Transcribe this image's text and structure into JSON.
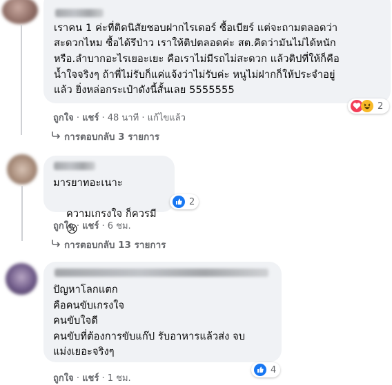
{
  "comments": [
    {
      "author": "",
      "lines": [
        "เราคน 1 ค่ะที่ติดนิสัยชอบฝากไรเดอร์ ซื้อเบียร์ แต่จะถามตลอดว่า",
        "สะดวกไหม ซื้อได้รึป่าว เราให้ติปตลอดค่ะ สต.คิดว่ามันไม่ได้หนัก",
        "หรือ.ลำบากอะไรเยอะเยะ คือเราไม่มีรถไม่สะดวก แล้วติปที่ให้ก็คือ",
        "น้ำใจจริงๆ ถ้าพี่ไม่รับก็แค่แจ้งว่าไม่รับค่ะ หนูไม่ฝากก็ให้ประจำอยู่",
        "แล้ว ยิ่งหล่อกระเป๋าดังนี้สั้นเลย 5555555"
      ],
      "actions": {
        "like": "ถูกใจ",
        "share": "แชร์",
        "time": "48 นาที",
        "edited": "แก้ไขแล้ว",
        "sep": "·"
      },
      "reactions": {
        "count": "2",
        "icons": [
          "love-icon",
          "haha-icon"
        ]
      },
      "replies": "การตอบกลับ 3 รายการ"
    },
    {
      "author": "",
      "lines": [
        "มารยาทอะเนาะ",
        "ความเกรงใจ ก็ควรมี"
      ],
      "emoji": "😢",
      "actions": {
        "like": "ถูกใจ",
        "share": "แชร์",
        "time": "6 ชม.",
        "sep": "·"
      },
      "reactions": {
        "count": "2",
        "icons": [
          "like-icon"
        ]
      },
      "replies": "การตอบกลับ 13 รายการ"
    },
    {
      "author": "",
      "lines": [
        "ปัญหาโลกแตก",
        "คือคนขับเกรงใจ",
        "คนขับใจดี",
        "คนขับที่ต้องการขับแก๊ป รับอาหารแล้วส่ง จบ",
        "แม่งเยอะจริงๆ"
      ],
      "actions": {
        "like": "ถูกใจ",
        "share": "แชร์",
        "time": "1 ชม.",
        "sep": "·"
      },
      "reactions": {
        "count": "4",
        "icons": [
          "like-icon"
        ]
      }
    }
  ],
  "colors": {
    "bubble": "#f0f2f5",
    "meta": "#65676b",
    "like": "#1877f2",
    "love": "#f33e58",
    "haha": "#f7b928"
  }
}
